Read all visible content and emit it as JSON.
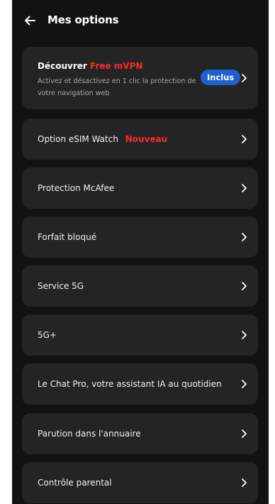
{
  "header": {
    "title": "Mes options",
    "back_icon": "arrow-left-icon"
  },
  "vpn_card": {
    "title_prefix": "Découvrer",
    "title_highlight": "Free mVPN",
    "description": "Activez et désactivez en 1 clic la protection de votre navigation web",
    "badge": "Inclus"
  },
  "options": [
    {
      "label": "Option eSIM Watch",
      "tag": "Nouveau"
    },
    {
      "label": "Protection McAfee"
    },
    {
      "label": "Forfait bloqué"
    },
    {
      "label": "Service 5G"
    },
    {
      "label": "5G+"
    },
    {
      "label": "Le Chat Pro, votre assistant IA au quotidien"
    },
    {
      "label": "Parution dans l'annuaire"
    },
    {
      "label": "Contrôle parental"
    }
  ],
  "colors": {
    "background": "#121212",
    "card": "#242424",
    "accent_red": "#ff2a2a",
    "badge_blue": "#1f5fcf"
  },
  "icons": {
    "chevron": "chevron-right-icon"
  }
}
